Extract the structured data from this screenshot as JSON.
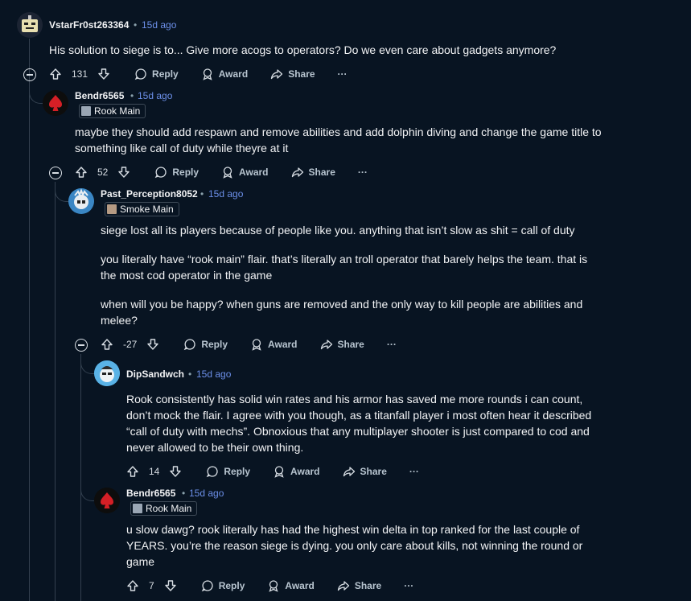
{
  "dot": "•",
  "labels": {
    "reply": "Reply",
    "award": "Award",
    "share": "Share",
    "more": "···"
  },
  "comments": [
    {
      "author": "VstarFr0st263364",
      "time": "15d ago",
      "body": [
        "His solution to siege is to... Give more acogs to operators? Do we even care about gadgets anymore?"
      ],
      "score": "131"
    },
    {
      "author": "Bendr6565",
      "time": "15d ago",
      "flair": "Rook Main",
      "body": [
        "maybe they should add respawn and remove abilities and add dolphin diving and change the game title to something like call of duty while theyre at it"
      ],
      "score": "52"
    },
    {
      "author": "Past_Perception8052",
      "time": "15d ago",
      "flair": "Smoke Main",
      "body": [
        "siege lost all its players because of people like you. anything that isn’t slow as shit = call of duty",
        "you literally have “rook main” flair. that’s literally an troll operator that barely helps the team. that is the most cod operator in the game",
        "when will you be happy? when guns are removed and the only way to kill people are abilities and melee?"
      ],
      "score": "-27"
    },
    {
      "author": "DipSandwch",
      "time": "15d ago",
      "body": [
        "Rook consistently has solid win rates and his armor has saved me more rounds i can count, don’t mock the flair. I agree with you though, as a titanfall player i most often hear it described “call of duty with mechs”. Obnoxious that any multiplayer shooter is just compared to cod and never allowed to be their own thing."
      ],
      "score": "14"
    },
    {
      "author": "Bendr6565",
      "time": "15d ago",
      "flair": "Rook Main",
      "body": [
        "u slow dawg? rook literally has had the highest win delta in top ranked for the last couple of YEARS. you’re the reason siege is dying. you only care about kills, not winning the round or game"
      ],
      "score": "7"
    }
  ]
}
